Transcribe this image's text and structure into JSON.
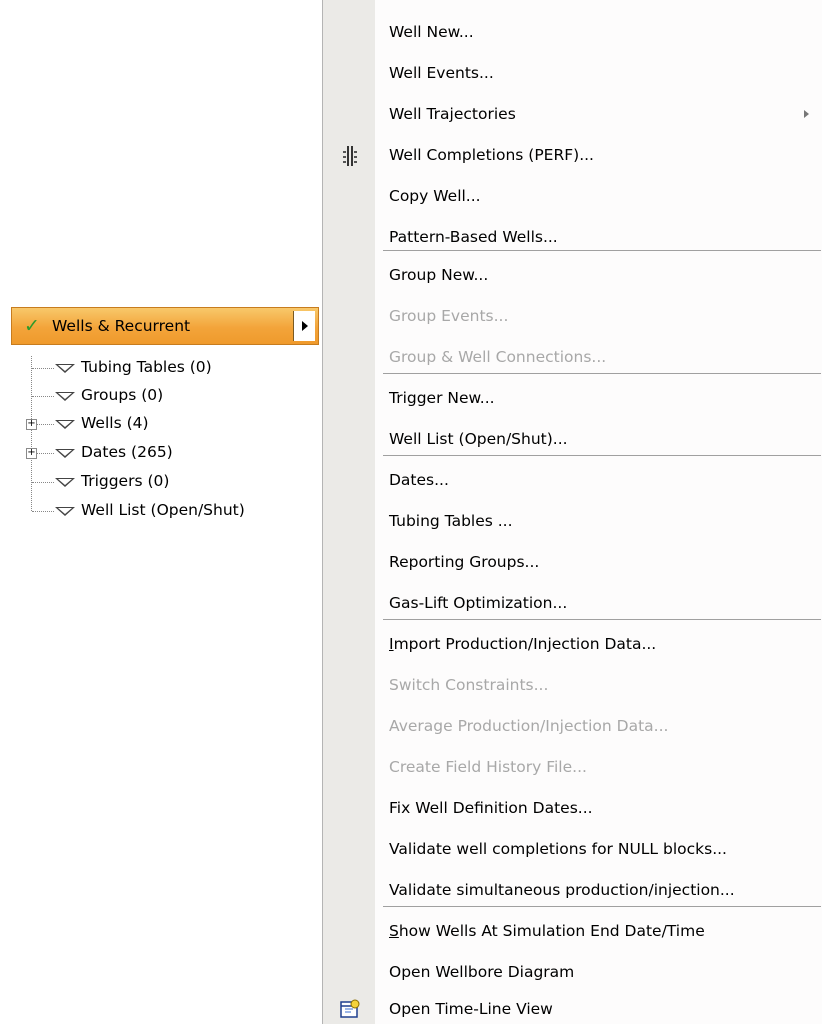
{
  "menu_button": {
    "label": "Wells & Recurrent"
  },
  "tree": {
    "items": [
      {
        "label": "Tubing Tables (0)"
      },
      {
        "label": "Groups (0)"
      },
      {
        "label": "Wells (4)",
        "expander": "+"
      },
      {
        "label": "Dates (265)",
        "expander": "+"
      },
      {
        "label": "Triggers (0)"
      },
      {
        "label": "Well List (Open/Shut)"
      }
    ]
  },
  "menu": {
    "items": [
      {
        "label": "Well New..."
      },
      {
        "label": "Well Events..."
      },
      {
        "label": "Well Trajectories",
        "submenu": true
      },
      {
        "label": "Well Completions (PERF)...",
        "icon": "perforation-icon"
      },
      {
        "label": "Copy Well..."
      },
      {
        "label": "Pattern-Based Wells..."
      },
      {
        "label": "Group New..."
      },
      {
        "label": "Group Events...",
        "disabled": true
      },
      {
        "label": "Group & Well Connections...",
        "disabled": true
      },
      {
        "label": "Trigger New..."
      },
      {
        "label": "Well List (Open/Shut)..."
      },
      {
        "label": "Dates..."
      },
      {
        "label": "Tubing Tables ..."
      },
      {
        "label": "Reporting Groups..."
      },
      {
        "label": "Gas-Lift Optimization..."
      },
      {
        "label": "Import Production/Injection Data...",
        "mnemonic": "I"
      },
      {
        "label": "Switch Constraints...",
        "disabled": true
      },
      {
        "label": "Average Production/Injection Data...",
        "disabled": true
      },
      {
        "label": "Create Field History File...",
        "disabled": true
      },
      {
        "label": "Fix Well Definition Dates..."
      },
      {
        "label": "Validate well completions for NULL blocks..."
      },
      {
        "label": "Validate simultaneous production/injection..."
      },
      {
        "label": "Show Wells At Simulation End Date/Time",
        "mnemonic": "S"
      },
      {
        "label": "Open Wellbore Diagram"
      },
      {
        "label": "Open Time-Line View",
        "icon": "timeline-view-icon"
      }
    ]
  },
  "colors": {
    "button_orange": "#f3a43a",
    "checkmark_green": "#2e9a2a",
    "disabled_text": "#a8a8a8",
    "menu_gutter": "#ebeae7"
  }
}
